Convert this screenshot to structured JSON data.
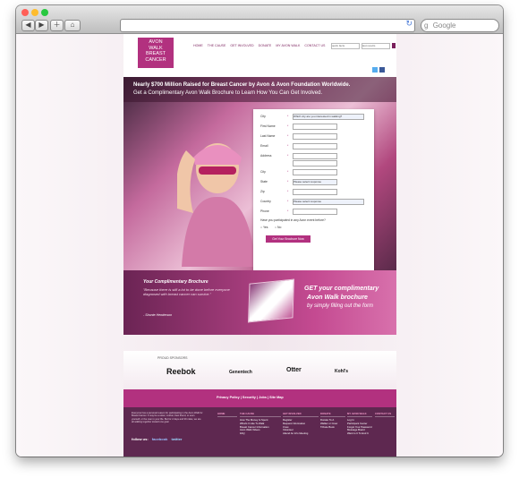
{
  "browser": {
    "search_placeholder": "Google",
    "traffic_lights": [
      "#ff5f57",
      "#febc2e",
      "#28c840"
    ]
  },
  "header": {
    "logo_lines": [
      "AVON",
      "WALK",
      "BREAST",
      "CANCER"
    ],
    "nav": [
      "HOME",
      "THE CAUSE",
      "GET INVOLVED",
      "DONATE",
      "MY AVON WALK",
      "CONTACT US"
    ],
    "search_value": "quick facts",
    "search_value2": "last results"
  },
  "hero": {
    "headline_line1": "Nearly $700 Million Raised for Breast Cancer by Avon & Avon Foundation Worldwide.",
    "headline_line2": "Get a Complimentary Avon Walk Brochure to Learn How You Can Get Involved."
  },
  "form": {
    "fields": [
      {
        "label": "City",
        "value": "Which city are you interested in walking?",
        "type": "select"
      },
      {
        "label": "First Name",
        "value": "",
        "type": "text"
      },
      {
        "label": "Last Name",
        "value": "",
        "type": "text"
      },
      {
        "label": "Email",
        "value": "",
        "type": "text"
      },
      {
        "label": "Address",
        "value": "",
        "type": "text"
      },
      {
        "label": "City",
        "value": "",
        "type": "text"
      },
      {
        "label": "State",
        "value": "Please select response",
        "type": "select"
      },
      {
        "label": "Zip",
        "value": "",
        "type": "text"
      },
      {
        "label": "Country",
        "value": "Please select response",
        "type": "select"
      },
      {
        "label": "Phone",
        "value": "",
        "type": "text"
      }
    ],
    "question": "Have you participated in any Avon event before?",
    "yes": "Yes",
    "no": "No",
    "submit": "Get Your Brochure Now"
  },
  "promo": {
    "title": "Your Complimentary Brochure",
    "quote": "\"Because there is still a lot to be done before everyone diagnosed with breast cancer can survive.\"",
    "author": "- Shonte Henderson",
    "get_line1": "GET your complimentary",
    "get_line2": "Avon Walk brochure",
    "get_line3": "by simply filling out the form"
  },
  "sponsors": {
    "heading": "PROUD SPONSORS",
    "names": [
      "Reebok",
      "Genentech",
      "Otter",
      "Kohl's"
    ]
  },
  "footer_bar": {
    "links": "Privacy Policy  |  Security  |  Jobs  |  Site Map"
  },
  "footer": {
    "description": "Everyone has a personal reason for participating in the Avon Walk for Breast Cancer. It may be a sister, mother, best friend, or even yourself, or the man in your life. But for 2 days and 39 miles, we are all walking together toward one goal.",
    "follow": "follow us:",
    "facebook": "facebook",
    "twitter": "twitter",
    "columns": [
      {
        "title": "HOME",
        "items": []
      },
      {
        "title": "THE CAUSE",
        "items": [
          "How The Money Is Spent",
          "What's It Like To Walk",
          "Breast Cancer Information",
          "Avon Walk Videos",
          "FAQ"
        ]
      },
      {
        "title": "GET INVOLVED",
        "items": [
          "Register",
          "Request Information",
          "Crew",
          "Volunteer",
          "Attend An Info Meeting"
        ]
      },
      {
        "title": "DONATE",
        "items": [
          "Donate To A",
          "Walker or Crew",
          "Tribute Book"
        ]
      },
      {
        "title": "MY AVON WALK",
        "items": [
          "Log In",
          "Participant Center",
          "Forgot Your Password",
          "Message Board",
          "Want to It To End It"
        ]
      },
      {
        "title": "CONTACT US",
        "items": []
      }
    ]
  }
}
